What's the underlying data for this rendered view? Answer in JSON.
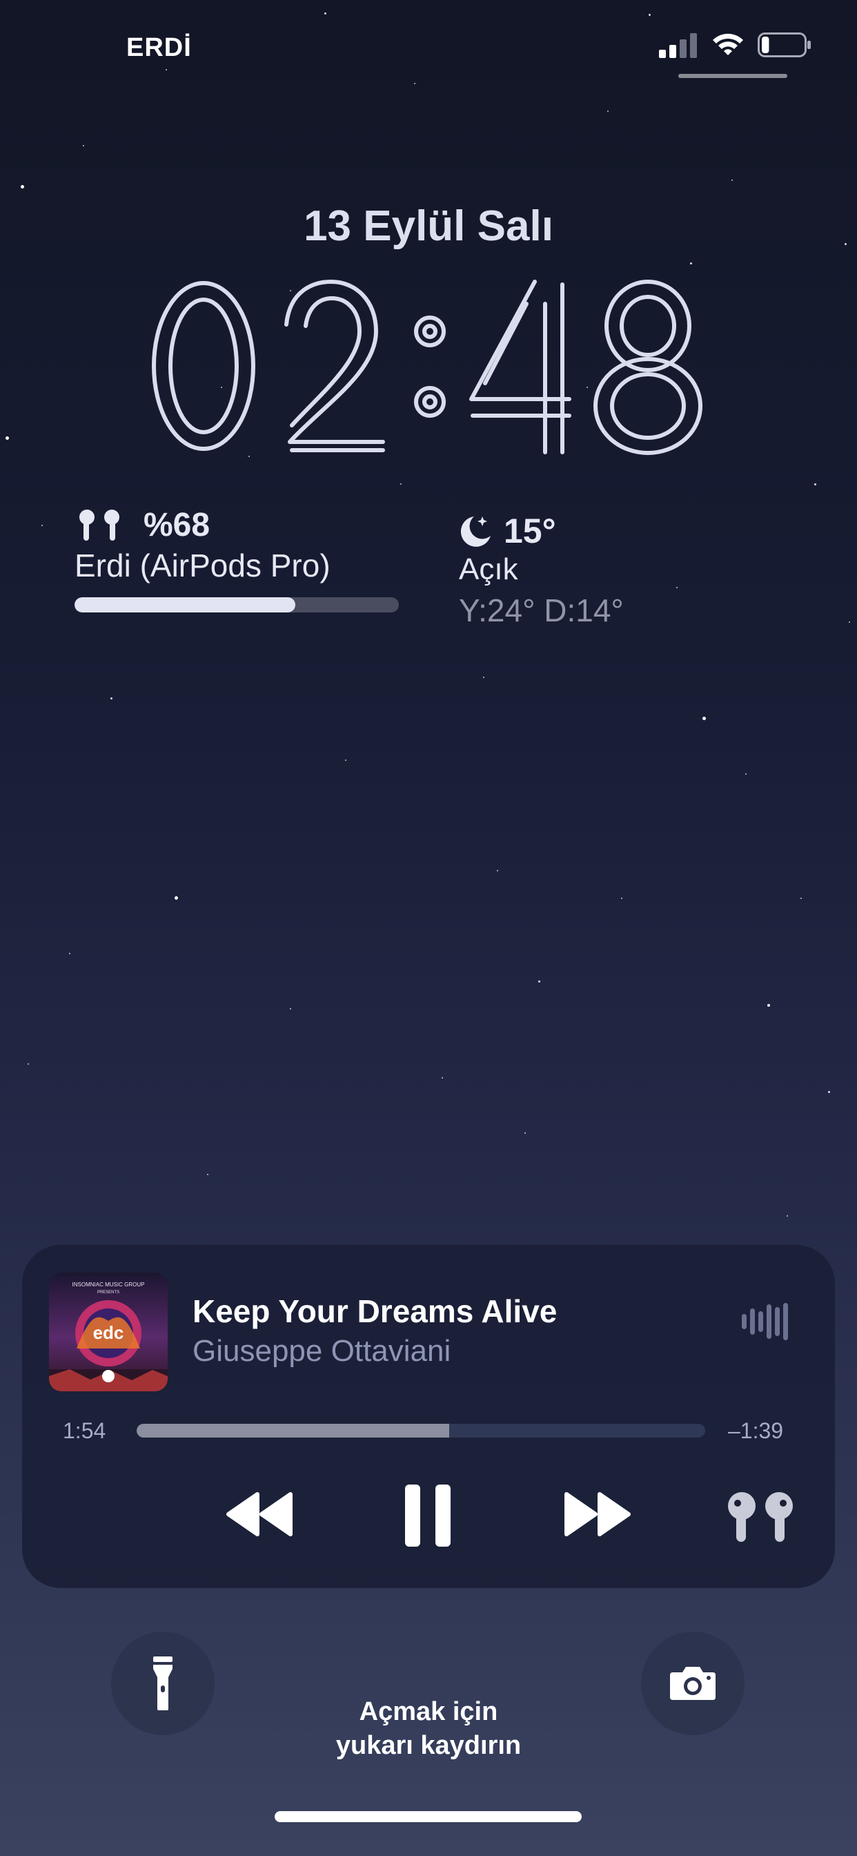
{
  "status_bar": {
    "carrier": "ERDİ",
    "signal_bars_active": 2,
    "signal_bars_total": 4,
    "battery_level": 0.18
  },
  "lock_screen": {
    "date": "13 Eylül Salı",
    "time": "02:48",
    "hour": "02",
    "minute": "48"
  },
  "widgets": {
    "airpods": {
      "percent_label": "%68",
      "device_name": "Erdi (AirPods Pro)",
      "level": 0.68
    },
    "weather": {
      "temperature": "15°",
      "condition": "Açık",
      "high_low": "Y:24° D:14°"
    }
  },
  "now_playing": {
    "title": "Keep Your Dreams Alive",
    "artist": "Giuseppe Ottaviani",
    "elapsed": "1:54",
    "remaining": "–1:39",
    "progress": 0.55,
    "artwork_text_top": "INSOMNIAC MUSIC GROUP",
    "artwork_text_sub": "PRESENTS",
    "artwork_logo": "edc"
  },
  "bottom": {
    "swipe_hint_line1": "Açmak için",
    "swipe_hint_line2": "yukarı kaydırın"
  },
  "icons": {
    "flashlight": "flashlight-icon",
    "camera": "camera-icon",
    "rewind": "rewind-icon",
    "pause": "pause-icon",
    "forward": "fast-forward-icon",
    "airpods": "airpods-icon",
    "moon": "moon-icon",
    "waveform": "waveform-icon"
  },
  "colors": {
    "background_top": "#121626",
    "background_bottom": "#3a4260",
    "player_bg": "#1a1f36",
    "progress_fill": "#8b8f9f",
    "text_secondary": "#8e95b4"
  }
}
